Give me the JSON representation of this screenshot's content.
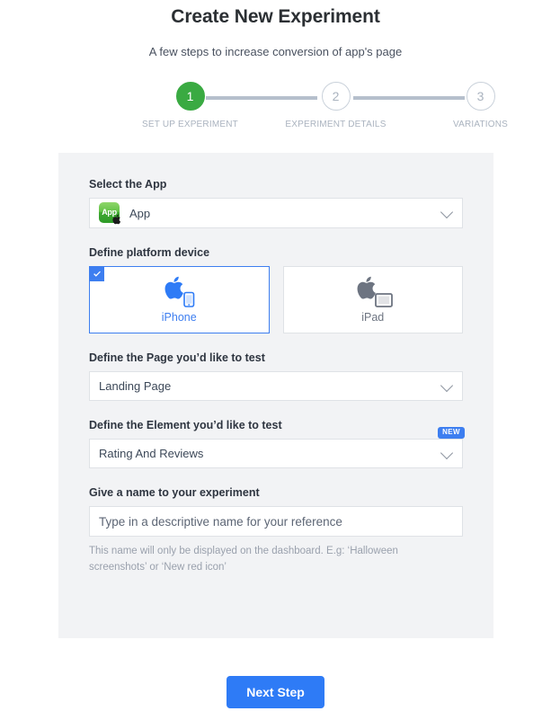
{
  "header": {
    "title": "Create New Experiment",
    "subtitle": "A few steps to increase conversion of app's page"
  },
  "stepper": {
    "active_color": "#3aaa42",
    "inactive_color": "#aab3bf",
    "steps": [
      {
        "number": "1",
        "label": "SET UP EXPERIMENT",
        "state": "active"
      },
      {
        "number": "2",
        "label": "EXPERIMENT DETAILS",
        "state": "inactive"
      },
      {
        "number": "3",
        "label": "VARIATIONS",
        "state": "inactive"
      }
    ]
  },
  "form": {
    "app": {
      "label": "Select the App",
      "value": "App",
      "icon_label": "App",
      "icon": "green-app-icon",
      "badge_icon": "apple-logo-icon",
      "chevron": "chevron-down-icon"
    },
    "platform": {
      "label": "Define platform device",
      "selected_color": "#3d7ef0",
      "options": [
        {
          "name": "iPhone",
          "icon": "apple-iphone-icon",
          "selected": true
        },
        {
          "name": "iPad",
          "icon": "apple-ipad-icon",
          "selected": false
        }
      ]
    },
    "page": {
      "label": "Define the Page you’d like to test",
      "value": "Landing Page",
      "chevron": "chevron-down-icon"
    },
    "element": {
      "label": "Define the Element you’d like to test",
      "value": "Rating And Reviews",
      "badge": "NEW",
      "chevron": "chevron-down-icon"
    },
    "name": {
      "label": "Give a name to your experiment",
      "value": "",
      "placeholder": "Type in a descriptive name for your reference",
      "helper": "This name will only be displayed on the dashboard. E.g: ‘Halloween screenshots’ or ‘New red icon’"
    }
  },
  "footer": {
    "next_label": "Next Step",
    "next_color": "#2e7bf6"
  }
}
